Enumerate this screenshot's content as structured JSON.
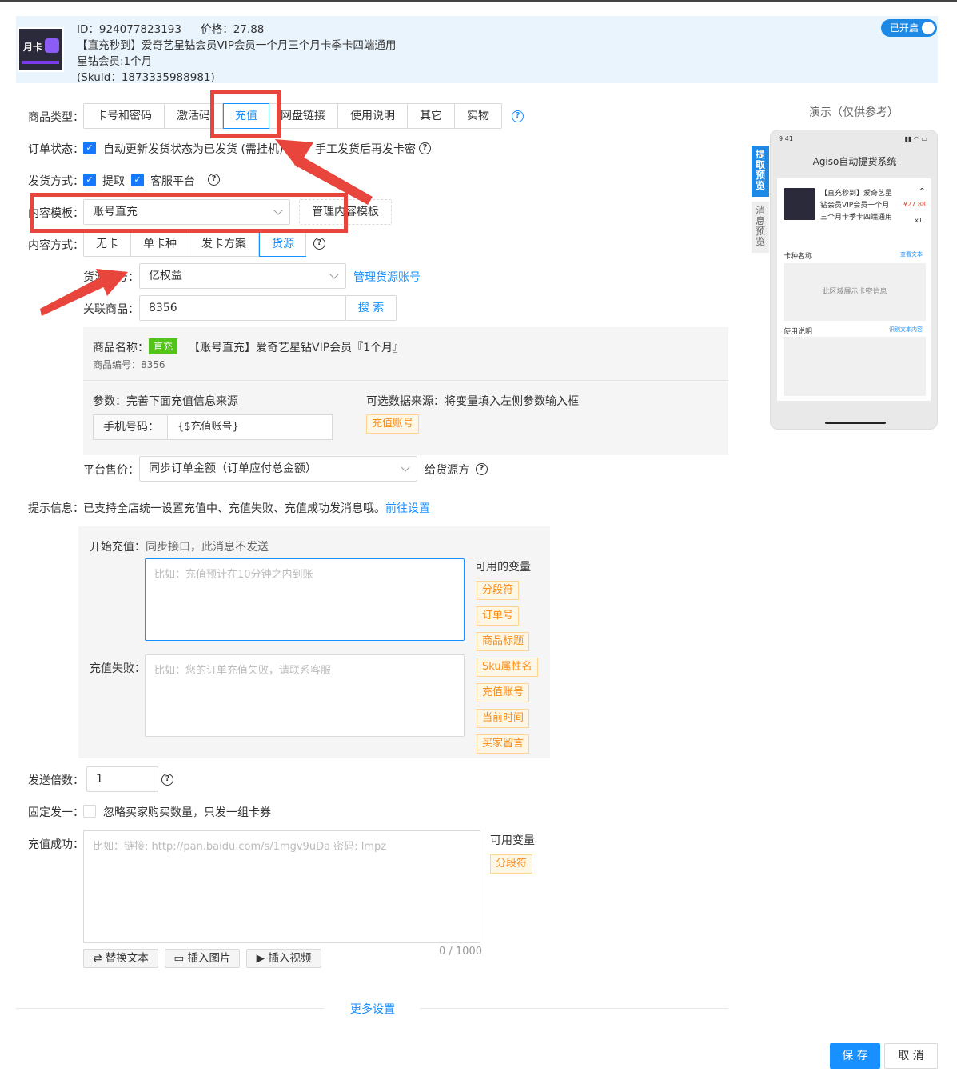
{
  "header": {
    "thumb_label": "月卡",
    "id_line": "ID：924077823193",
    "price_line": "价格：27.88",
    "title": "【直充秒到】爱奇艺星钻会员VIP会员一个月三个月卡季卡四端通用",
    "sku_name": "星钻会员:1个月",
    "sku_id": "(SkuId：1873335988981)",
    "toggle_label": "已开启"
  },
  "form": {
    "product_type": {
      "label": "商品类型：",
      "options": [
        "卡号和密码",
        "激活码",
        "充值",
        "网盘链接",
        "使用说明",
        "其它",
        "实物"
      ],
      "selected": "充值"
    },
    "order_status": {
      "label": "订单状态：",
      "option1": "自动更新发货状态为已发货 (需挂机)",
      "option2": "手工发货后再发卡密"
    },
    "delivery": {
      "label": "发货方式：",
      "opt1": "提取",
      "opt2": "客服平台"
    },
    "template": {
      "label": "内容模板：",
      "value": "账号直充",
      "manage_btn": "管理内容模板"
    },
    "content_mode": {
      "label": "内容方式：",
      "options": [
        "无卡",
        "单卡种",
        "发卡方案",
        "货源"
      ],
      "selected": "货源"
    },
    "source_account": {
      "label": "货源账号：",
      "value": "亿权益",
      "link": "管理货源账号"
    },
    "linked_product": {
      "label": "关联商品：",
      "value": "8356",
      "btn": "搜 索"
    },
    "product_info": {
      "name_label": "商品名称：",
      "badge": "直充",
      "name": "【账号直充】爱奇艺星钻VIP会员『1个月』",
      "code": "商品编号：8356",
      "params_label": "参数：完善下面充值信息来源",
      "optional_label": "可选数据来源：将变量填入左侧参数输入框",
      "phone_label": "手机号码：",
      "phone_value": "{$充值账号}",
      "var_tag": "充值账号"
    },
    "platform_price": {
      "label": "平台售价：",
      "value": "同步订单金额（订单应付总金额）",
      "suffix": "给货源方"
    },
    "tip": {
      "label": "提示信息：",
      "text": "已支持全店统一设置充值中、充值失败、充值成功发消息哦。",
      "link": "前往设置"
    },
    "start_charge": {
      "label": "开始充值：",
      "note": "同步接口，此消息不发送",
      "placeholder": "比如：充值预计在10分钟之内到账"
    },
    "charge_fail": {
      "label": "充值失败：",
      "placeholder": "比如：您的订单充值失败，请联系客服"
    },
    "variables": {
      "title": "可用的变量",
      "items": [
        "分段符",
        "订单号",
        "商品标题",
        "Sku属性名",
        "充值账号",
        "当前时间",
        "买家留言"
      ]
    },
    "send_multiple": {
      "label": "发送倍数：",
      "value": "1"
    },
    "fixed_one": {
      "label": "固定发一：",
      "text": "忽略买家购买数量，只发一组卡券"
    },
    "charge_success": {
      "label": "充值成功：",
      "placeholder": "比如：链接: http://pan.baidu.com/s/1mgv9uDa 密码: lmpz",
      "counter": "0 / 1000",
      "var_title": "可用变量",
      "var_item": "分段符"
    },
    "toolbar": {
      "replace": "替换文本",
      "insert_image": "插入图片",
      "insert_video": "插入视频"
    },
    "more": "更多设置"
  },
  "preview": {
    "title": "演示（仅供参考）",
    "tab1": "提取预览",
    "tab2": "消息预览",
    "time": "9:41",
    "app_title": "Agiso自动提货系统",
    "product": "【直充秒到】爱奇艺星钻会员VIP会员一个月三个月卡季卡四端通用",
    "price": "¥27.88",
    "qty": "x1",
    "card_name": "卡种名称",
    "view_text": "查看文本",
    "card_area": "此区域展示卡密信息",
    "usage": "使用说明",
    "identify": "识别文本内容"
  },
  "footer": {
    "save": "保 存",
    "cancel": "取 消"
  },
  "colors": {
    "primary": "#1890ff",
    "annotation": "#e8453c",
    "tag_orange": "#fa8c16"
  }
}
